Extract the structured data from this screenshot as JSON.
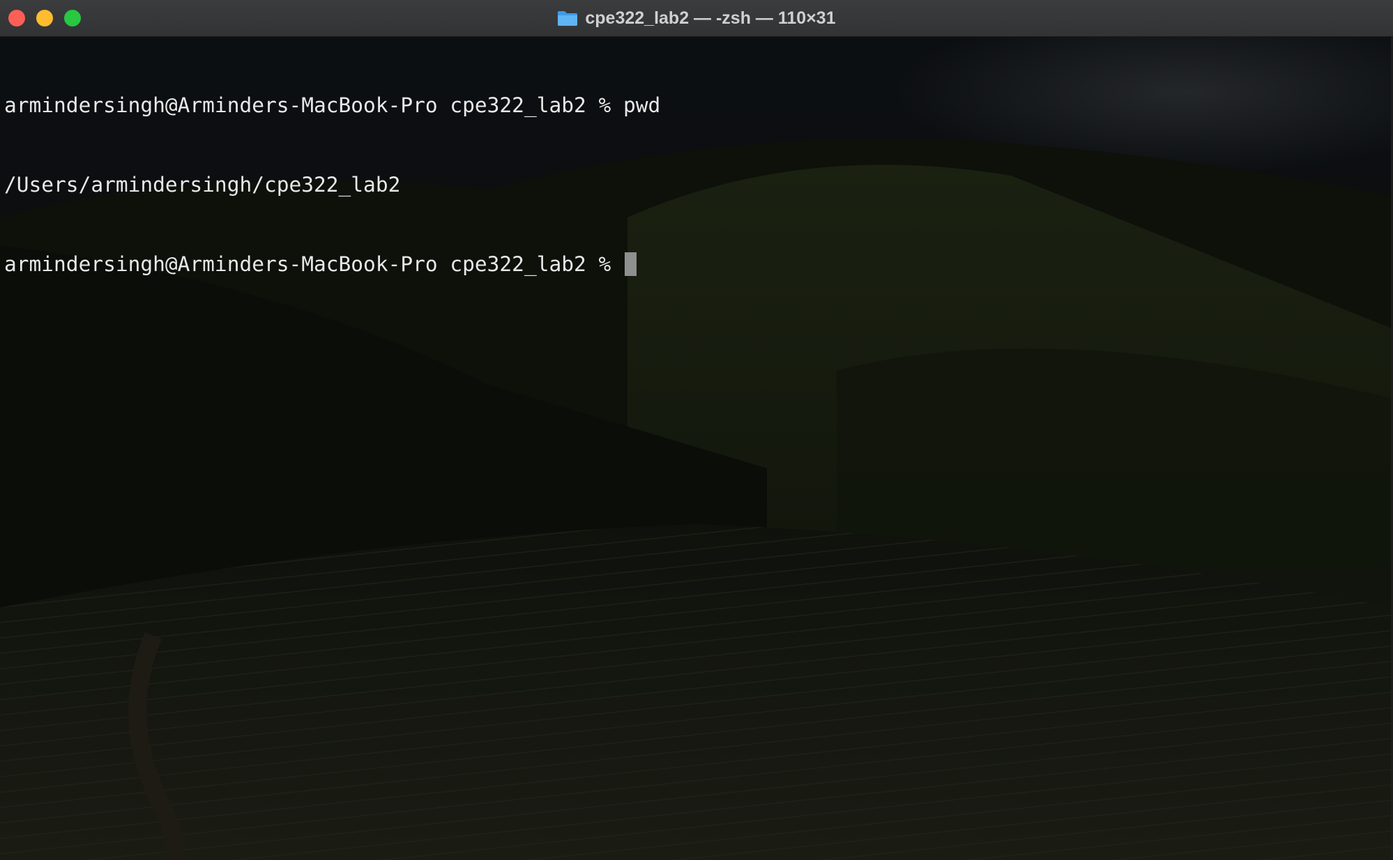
{
  "window": {
    "title": "cpe322_lab2 — -zsh — 110×31",
    "title_icon": "folder-icon",
    "traffic_lights": {
      "close_color": "#fe5f57",
      "minimize_color": "#febc2e",
      "zoom_color": "#28c840"
    }
  },
  "terminal": {
    "lines": [
      "armindersingh@Arminders-MacBook-Pro cpe322_lab2 % pwd",
      "/Users/armindersingh/cpe322_lab2",
      "armindersingh@Arminders-MacBook-Pro cpe322_lab2 % "
    ],
    "text_color": "#e8e8e8",
    "cursor_color": "#8f8f8f"
  }
}
